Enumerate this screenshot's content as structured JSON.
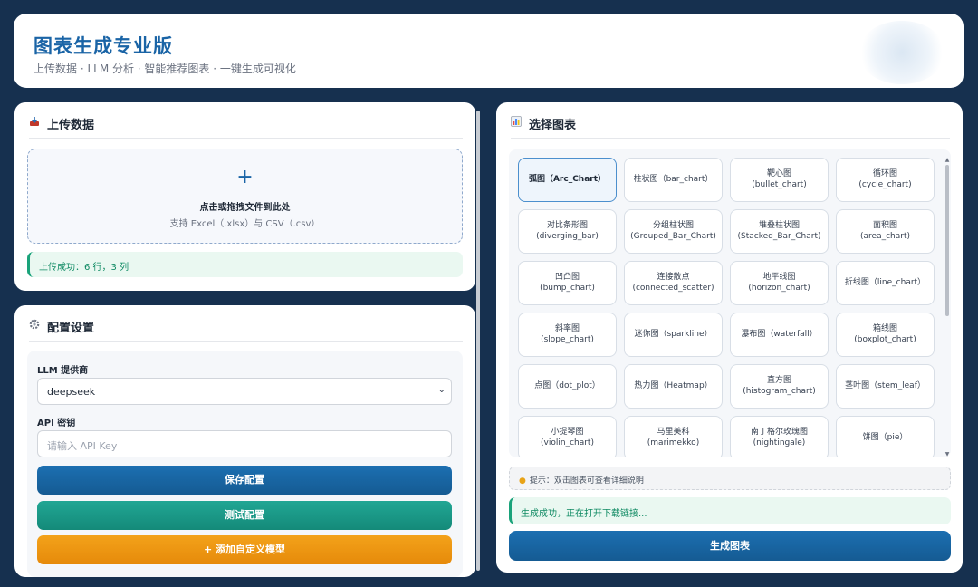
{
  "header": {
    "title": "图表生成专业版",
    "subtitle": "上传数据 · LLM 分析 · 智能推荐图表 · 一键生成可视化"
  },
  "upload": {
    "title": "上传数据",
    "title_icon": "inbox-tray-icon",
    "drop_plus": "+",
    "drop_main": "点击或拖拽文件到此处",
    "drop_hint": "支持 Excel（.xlsx）与 CSV（.csv）",
    "success": "上传成功：6 行，3 列"
  },
  "config": {
    "title": "配置设置",
    "title_icon": "gear-icon",
    "provider_label": "LLM 提供商",
    "provider_value": "deepseek",
    "api_label": "API 密钥",
    "api_placeholder": "请输入 API Key",
    "save_label": "保存配置",
    "test_label": "测试配置",
    "add_label": "+ 添加自定义模型"
  },
  "chart_select": {
    "title": "选择图表",
    "title_icon": "bar-chart-icon",
    "items": [
      {
        "lines": [
          "弧图（Arc_Chart）"
        ],
        "selected": true
      },
      {
        "lines": [
          "柱状图（bar_chart）"
        ]
      },
      {
        "lines": [
          "靶心图",
          "(bullet_chart)"
        ]
      },
      {
        "lines": [
          "循环图",
          "(cycle_chart)"
        ]
      },
      {
        "lines": [
          "对比条形图",
          "(diverging_bar)"
        ]
      },
      {
        "lines": [
          "分组柱状图",
          "(Grouped_Bar_Chart)"
        ]
      },
      {
        "lines": [
          "堆叠柱状图",
          "(Stacked_Bar_Chart)"
        ]
      },
      {
        "lines": [
          "面积图",
          "(area_chart)"
        ]
      },
      {
        "lines": [
          "凹凸图",
          "(bump_chart)"
        ]
      },
      {
        "lines": [
          "连接散点",
          "(connected_scatter)"
        ]
      },
      {
        "lines": [
          "地平线图",
          "(horizon_chart)"
        ]
      },
      {
        "lines": [
          "折线图（line_chart）"
        ]
      },
      {
        "lines": [
          "斜率图",
          "(slope_chart)"
        ]
      },
      {
        "lines": [
          "迷你图（sparkline）"
        ]
      },
      {
        "lines": [
          "瀑布图（waterfall）"
        ]
      },
      {
        "lines": [
          "箱线图",
          "(boxplot_chart)"
        ]
      },
      {
        "lines": [
          "点图（dot_plot）"
        ]
      },
      {
        "lines": [
          "热力图（Heatmap）"
        ]
      },
      {
        "lines": [
          "直方图",
          "(histogram_chart)"
        ]
      },
      {
        "lines": [
          "茎叶图（stem_leaf）"
        ]
      },
      {
        "lines": [
          "小提琴图",
          "(violin_chart)"
        ]
      },
      {
        "lines": [
          "马里美科",
          "(marimekko)"
        ]
      },
      {
        "lines": [
          "南丁格尔玫瑰图",
          "(nightingale)"
        ]
      },
      {
        "lines": [
          "饼图（pie）"
        ]
      }
    ],
    "tip": "提示：双击图表可查看详细说明",
    "success": "生成成功，正在打开下载链接...",
    "generate_label": "生成图表"
  }
}
